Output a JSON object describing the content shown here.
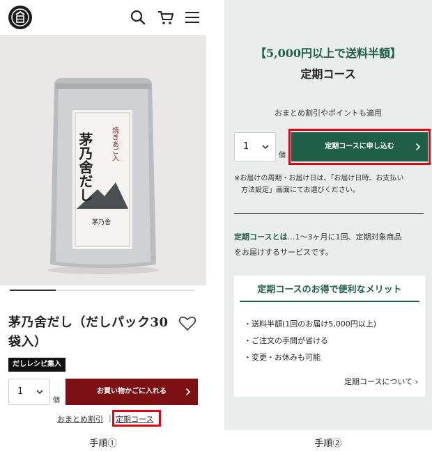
{
  "step1": {
    "caption": "手順①",
    "header": {
      "logo_icon": "brand-logo",
      "search_icon": "search-icon",
      "cart_icon": "cart-icon",
      "menu_icon": "hamburger-menu-icon"
    },
    "product": {
      "package_text": {
        "brand_large": "茅乃舍だし",
        "flavor": "焼きあご入",
        "maker_small": "茅乃舎"
      },
      "title": "茅乃舍だし（だしパック30袋入）",
      "badge": "だしレシピ集入",
      "quantity": "1",
      "quantity_unit": "個",
      "add_to_cart": "お買い物かごに入れる",
      "link_bulk": "おまとめ割引",
      "link_separator": "|",
      "link_subscription": "定期コース"
    }
  },
  "step2": {
    "caption": "手順②",
    "banner": "【5,000円以上で送料半額】",
    "title": "定期コース",
    "applies_note": "おまとめ割引やポイントも適用",
    "quantity": "1",
    "quantity_unit": "個",
    "apply_button": "定期コースに申し込む",
    "note_line1": "※お届けの周期・お届け日は、「お届け日時、お支払い",
    "note_line2": "方法設定」画面にてお選びください。",
    "about_strong": "定期コースとは",
    "about_text1": "…1～3ヶ月に1回、定期対象商品",
    "about_text2": "をお届けするサービスです。",
    "merit_title": "定期コースのお得で便利なメリット",
    "merits": [
      "・送料半額(1回のお届け5,000円以上)",
      "・ご注文の手間が省ける",
      "・変更・お休みも可能"
    ],
    "merit_link": "定期コースについて ›"
  },
  "colors": {
    "accent_red": "#7c1013",
    "accent_green": "#1f5e47",
    "highlight_box": "#e60012",
    "panel_bg": "#e9eeec"
  }
}
